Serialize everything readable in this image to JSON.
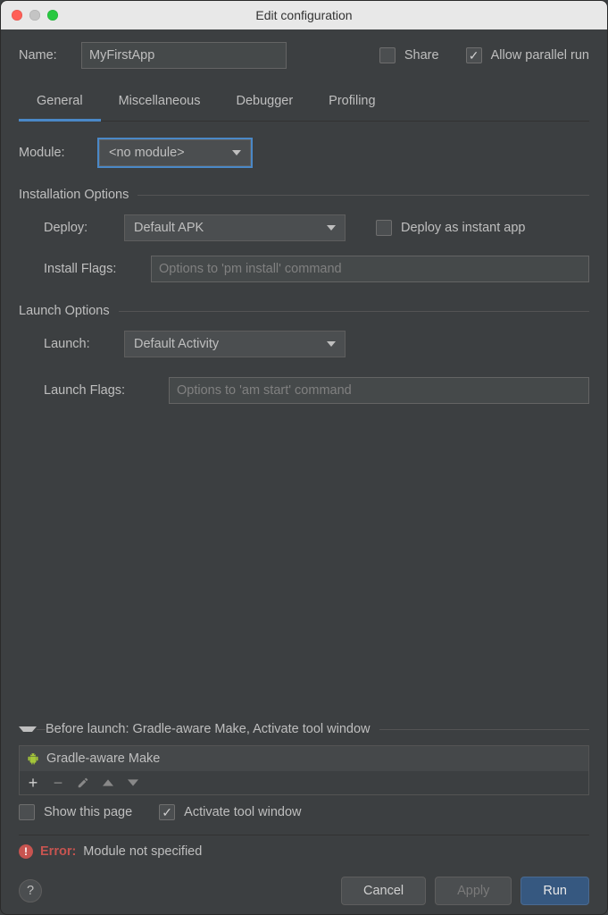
{
  "window": {
    "title": "Edit configuration"
  },
  "name": {
    "label": "Name:",
    "value": "MyFirstApp"
  },
  "share": {
    "label": "Share",
    "checked": false
  },
  "allow_parallel": {
    "label": "Allow parallel run",
    "checked": true
  },
  "tabs": {
    "general": "General",
    "miscellaneous": "Miscellaneous",
    "debugger": "Debugger",
    "profiling": "Profiling"
  },
  "module": {
    "label": "Module:",
    "value": "<no module>"
  },
  "installation": {
    "legend": "Installation Options",
    "deploy_label": "Deploy:",
    "deploy_value": "Default APK",
    "deploy_instant_label": "Deploy as instant app",
    "install_flags_label": "Install Flags:",
    "install_flags_placeholder": "Options to 'pm install' command"
  },
  "launch": {
    "legend": "Launch Options",
    "launch_label": "Launch:",
    "launch_value": "Default Activity",
    "launch_flags_label": "Launch Flags:",
    "launch_flags_placeholder": "Options to 'am start' command"
  },
  "before_launch": {
    "header": "Before launch: Gradle-aware Make, Activate tool window",
    "task": "Gradle-aware Make",
    "show_this_page": "Show this page",
    "activate_tool_window": "Activate tool window"
  },
  "error": {
    "prefix": "Error:",
    "message": "Module not specified"
  },
  "buttons": {
    "cancel": "Cancel",
    "apply": "Apply",
    "run": "Run",
    "help": "?"
  }
}
